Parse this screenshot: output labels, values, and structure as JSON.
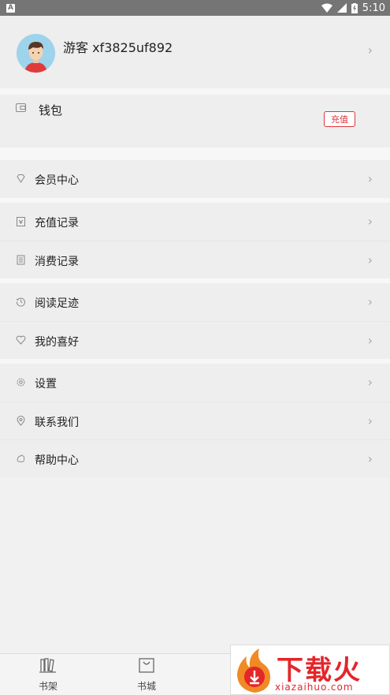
{
  "status_bar": {
    "time": "5:10",
    "left_icon": "A"
  },
  "profile": {
    "username": "游客 xf3825uf892"
  },
  "wallet": {
    "label": "钱包",
    "recharge_button": "充值"
  },
  "menu": {
    "vip": "会员中心",
    "recharge_records": "充值记录",
    "consume_records": "消费记录",
    "reading_history": "阅读足迹",
    "favorites": "我的喜好",
    "settings": "设置",
    "contact": "联系我们",
    "help": "帮助中心"
  },
  "bottom_nav": {
    "bookshelf": "书架",
    "bookstore": "书城"
  },
  "watermark": {
    "title": "下载火",
    "url": "xiazaihuo.com"
  },
  "colors": {
    "accent": "#e0353a",
    "background": "#eeeeee"
  }
}
